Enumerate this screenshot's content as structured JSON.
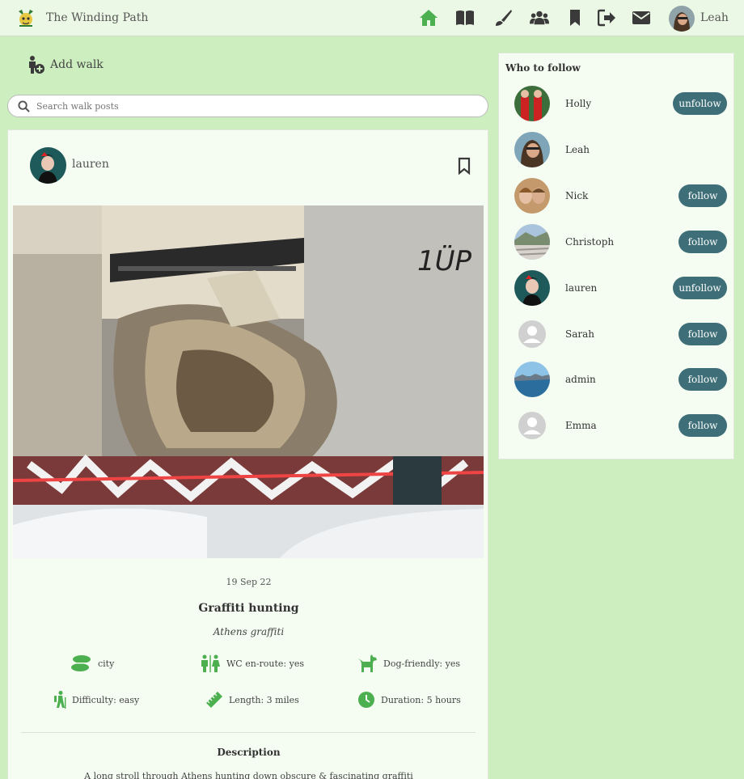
{
  "brand": {
    "name": "The Winding Path"
  },
  "nav": {
    "items": [
      {
        "icon": "home-icon"
      },
      {
        "icon": "book-icon"
      },
      {
        "icon": "paintbrush-icon"
      },
      {
        "icon": "users-icon"
      },
      {
        "icon": "bookmark-icon"
      },
      {
        "icon": "sign-out-icon"
      },
      {
        "icon": "envelope-icon"
      }
    ],
    "user": "Leah",
    "active_color": "#4caf50"
  },
  "add_walk": {
    "label": "Add walk"
  },
  "search": {
    "placeholder": "Search walk posts"
  },
  "post": {
    "author": "lauren",
    "date": "19 Sep 22",
    "title": "Graffiti hunting",
    "subtitle": "Athens graffiti",
    "attributes": [
      {
        "icon": "footsteps-icon",
        "text": "city"
      },
      {
        "icon": "restroom-icon",
        "text": "WC en-route: yes"
      },
      {
        "icon": "dog-icon",
        "text": "Dog-friendly: yes"
      },
      {
        "icon": "hiking-icon",
        "text": "Difficulty: easy"
      },
      {
        "icon": "ruler-icon",
        "text": "Length: 3 miles"
      },
      {
        "icon": "clock-icon",
        "text": "Duration: 5 hours"
      }
    ],
    "description_heading": "Description",
    "description": "A long stroll through Athens hunting down obscure & fascinating graffiti"
  },
  "who_to_follow": {
    "heading": "Who to follow",
    "users": [
      {
        "name": "Holly",
        "button": "unfollow"
      },
      {
        "name": "Leah",
        "button": ""
      },
      {
        "name": "Nick",
        "button": "follow"
      },
      {
        "name": "Christoph",
        "button": "follow"
      },
      {
        "name": "lauren",
        "button": "unfollow"
      },
      {
        "name": "Sarah",
        "button": "follow"
      },
      {
        "name": "admin",
        "button": "follow"
      },
      {
        "name": "Emma",
        "button": "follow"
      }
    ]
  },
  "colors": {
    "page_bg": "#cdefbf",
    "accent": "#4caf50",
    "button": "#3e6f78"
  }
}
